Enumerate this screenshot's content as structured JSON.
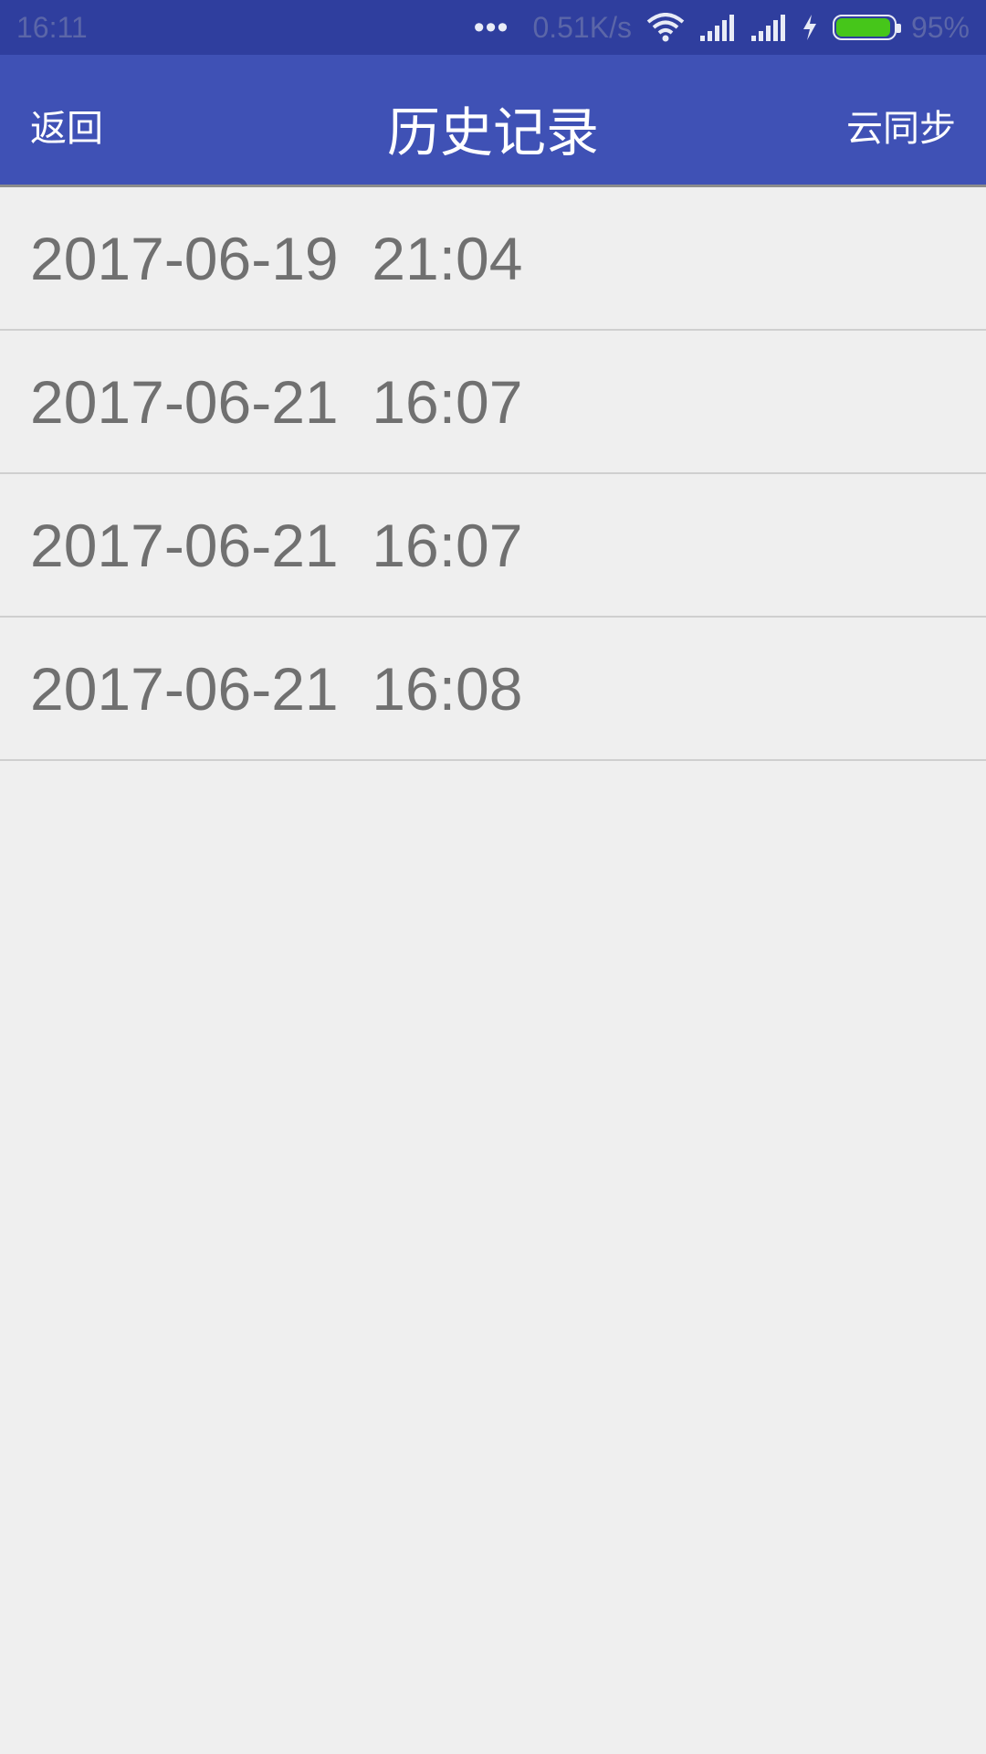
{
  "status_bar": {
    "time": "16:11",
    "dots": "•••",
    "net_speed": "0.51K/s",
    "battery_percent": "95%",
    "battery_level": 0.95,
    "icons": [
      "wifi-icon",
      "signal-icon",
      "signal-icon",
      "charging-icon",
      "battery-icon"
    ]
  },
  "header": {
    "back_label": "返回",
    "title": "历史记录",
    "sync_label": "云同步",
    "accent_color": "#3f51b5"
  },
  "history": {
    "items": [
      {
        "text": "2017-06-19  21:04"
      },
      {
        "text": "2017-06-21  16:07"
      },
      {
        "text": "2017-06-21  16:07"
      },
      {
        "text": "2017-06-21  16:08"
      }
    ]
  }
}
